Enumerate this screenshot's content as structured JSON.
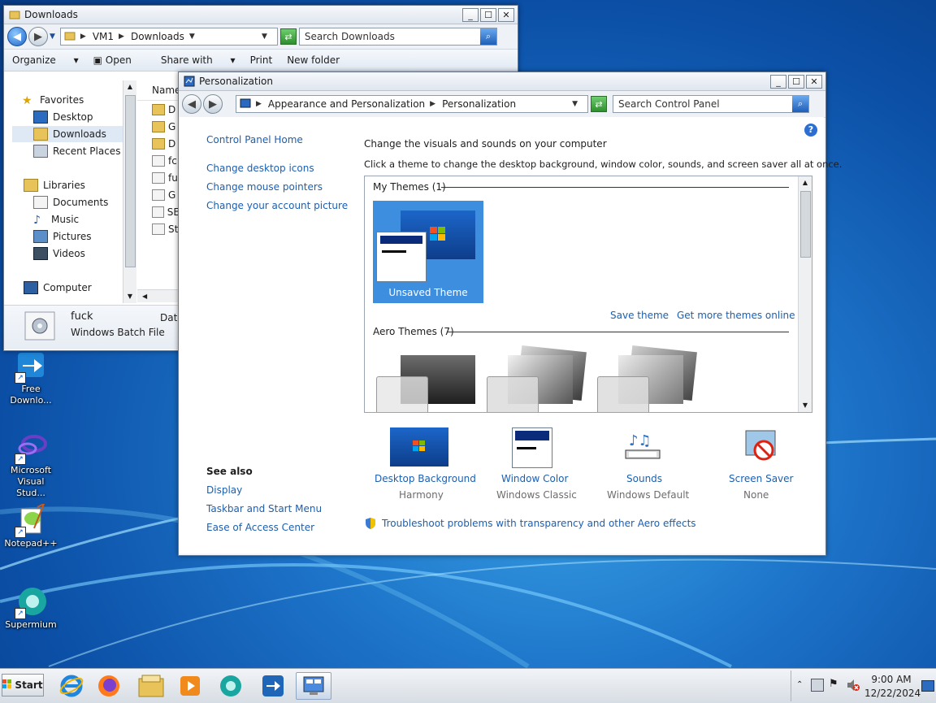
{
  "explorer": {
    "title": "Downloads",
    "breadcrumb": [
      "VM1",
      "Downloads"
    ],
    "search_placeholder": "Search Downloads",
    "toolbar": [
      "Organize",
      "Open",
      "Share with",
      "Print",
      "New folder"
    ],
    "nav": {
      "favorites": "Favorites",
      "desktop": "Desktop",
      "downloads": "Downloads",
      "recent": "Recent Places",
      "libraries": "Libraries",
      "documents": "Documents",
      "music": "Music",
      "pictures": "Pictures",
      "videos": "Videos",
      "computer": "Computer"
    },
    "column_header": "Name",
    "file_rows": [
      "D",
      "G",
      "D",
      "fc",
      "fu",
      "G",
      "SE",
      "St"
    ],
    "details": {
      "name": "fuck",
      "type": "Windows Batch File",
      "date_label": "Date"
    }
  },
  "personalization": {
    "title": "Personalization",
    "breadcrumb": [
      "Appearance and Personalization",
      "Personalization"
    ],
    "search_placeholder": "Search Control Panel",
    "left_links": {
      "home": "Control Panel Home",
      "desktop_icons": "Change desktop icons",
      "mouse_pointers": "Change mouse pointers",
      "account_picture": "Change your account picture"
    },
    "see_also": {
      "heading": "See also",
      "display": "Display",
      "taskbar": "Taskbar and Start Menu",
      "ease": "Ease of Access Center"
    },
    "heading": "Change the visuals and sounds on your computer",
    "description": "Click a theme to change the desktop background, window color, sounds, and screen saver all at once.",
    "my_themes_label": "My Themes (1)",
    "unsaved_theme": "Unsaved Theme",
    "save_theme": "Save theme",
    "get_more": "Get more themes online",
    "aero_themes_label": "Aero Themes (7)",
    "bottom": {
      "background": {
        "label": "Desktop Background",
        "value": "Harmony"
      },
      "color": {
        "label": "Window Color",
        "value": "Windows Classic"
      },
      "sounds": {
        "label": "Sounds",
        "value": "Windows Default"
      },
      "screensaver": {
        "label": "Screen Saver",
        "value": "None"
      }
    },
    "troubleshoot": "Troubleshoot problems with transparency and other Aero effects"
  },
  "desktop_icons": {
    "free": "Free Downlo...",
    "vs": "Microsoft Visual Stud...",
    "notepad": "Notepad++",
    "supermium": "Supermium"
  },
  "taskbar": {
    "start": "Start",
    "time": "9:00 AM",
    "date": "12/22/2024"
  }
}
